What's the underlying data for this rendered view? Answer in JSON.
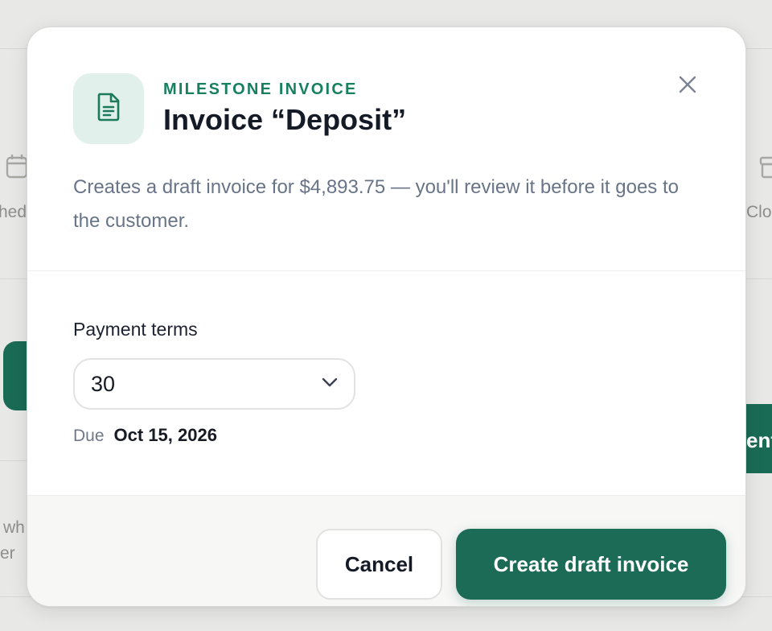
{
  "background": {
    "left_text_1": "hed",
    "left_text_2": "wh",
    "left_text_3": "er",
    "right_text_1": "Clo",
    "right_button_text": "ent"
  },
  "modal": {
    "icon": "document-icon",
    "eyebrow": "MILESTONE INVOICE",
    "title": "Invoice “Deposit”",
    "description": "Creates a draft invoice for $4,893.75 — you'll review it before it goes to the customer.",
    "payment_terms": {
      "label": "Payment terms",
      "selected": "30"
    },
    "due": {
      "label": "Due",
      "value": "Oct 15, 2026"
    },
    "actions": {
      "cancel_label": "Cancel",
      "primary_label": "Create draft invoice"
    }
  },
  "colors": {
    "accent": "#1b6b56",
    "eyebrow": "#17805f",
    "icon_tile": "#e2f0eb"
  }
}
